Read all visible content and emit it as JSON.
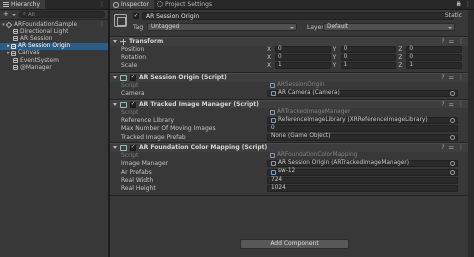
{
  "hierarchy": {
    "tab_label": "Hierarchy",
    "search_placeholder": "All",
    "items": [
      {
        "label": "ARFoundationSample"
      },
      {
        "label": "Directional Light"
      },
      {
        "label": "AR Session"
      },
      {
        "label": "AR Session Origin"
      },
      {
        "label": "Canvas"
      },
      {
        "label": "EventSystem"
      },
      {
        "label": "@Manager"
      }
    ]
  },
  "inspector": {
    "tabs": [
      {
        "label": "Inspector"
      },
      {
        "label": "Project Settings"
      }
    ],
    "gameobject": {
      "name": "AR Session Origin",
      "static_label": "Static",
      "tag_label": "Tag",
      "tag_value": "Untagged",
      "layer_label": "Layer",
      "layer_value": "Default"
    },
    "transform": {
      "title": "Transform",
      "rows": [
        {
          "label": "Position",
          "x": "0",
          "y": "0",
          "z": "0"
        },
        {
          "label": "Rotation",
          "x": "0",
          "y": "0",
          "z": "0"
        },
        {
          "label": "Scale",
          "x": "1",
          "y": "1",
          "z": "1"
        }
      ]
    },
    "ar_session_origin": {
      "title": "AR Session Origin (Script)",
      "script_label": "Script",
      "script_value": "ARSessionOrigin",
      "camera_label": "Camera",
      "camera_value": "AR Camera (Camera)"
    },
    "ar_tracked_image_manager": {
      "title": "AR Tracked Image Manager (Script)",
      "script_label": "Script",
      "script_value": "ARTrackedImageManager",
      "ref_lib_label": "Reference Library",
      "ref_lib_value": "ReferenceImageLibrary (XRReferenceImageLibrary)",
      "max_moving_label": "Max Number Of Moving Images",
      "max_moving_value": "0",
      "prefab_label": "Tracked Image Prefab",
      "prefab_value": "None (Game Object)"
    },
    "ar_foundation_color_mapping": {
      "title": "AR Foundation Color Mapping (Script)",
      "script_label": "Script",
      "script_value": "ARFoundationColorMapping",
      "image_manager_label": "Image Manager",
      "image_manager_value": "AR Session Origin (ARTrackedImageManager)",
      "ar_prefabs_label": "Ar Prefabs",
      "ar_prefabs_value": "sw-12",
      "real_width_label": "Real Width",
      "real_width_value": "724",
      "real_height_label": "Real Height",
      "real_height_value": "1024"
    },
    "add_component_label": "Add Component"
  },
  "icons": {
    "axis_x": "X",
    "axis_y": "Y",
    "axis_z": "Z",
    "kebab": "⋮",
    "help": "?",
    "settings": "⚌",
    "lock": "🔒"
  }
}
